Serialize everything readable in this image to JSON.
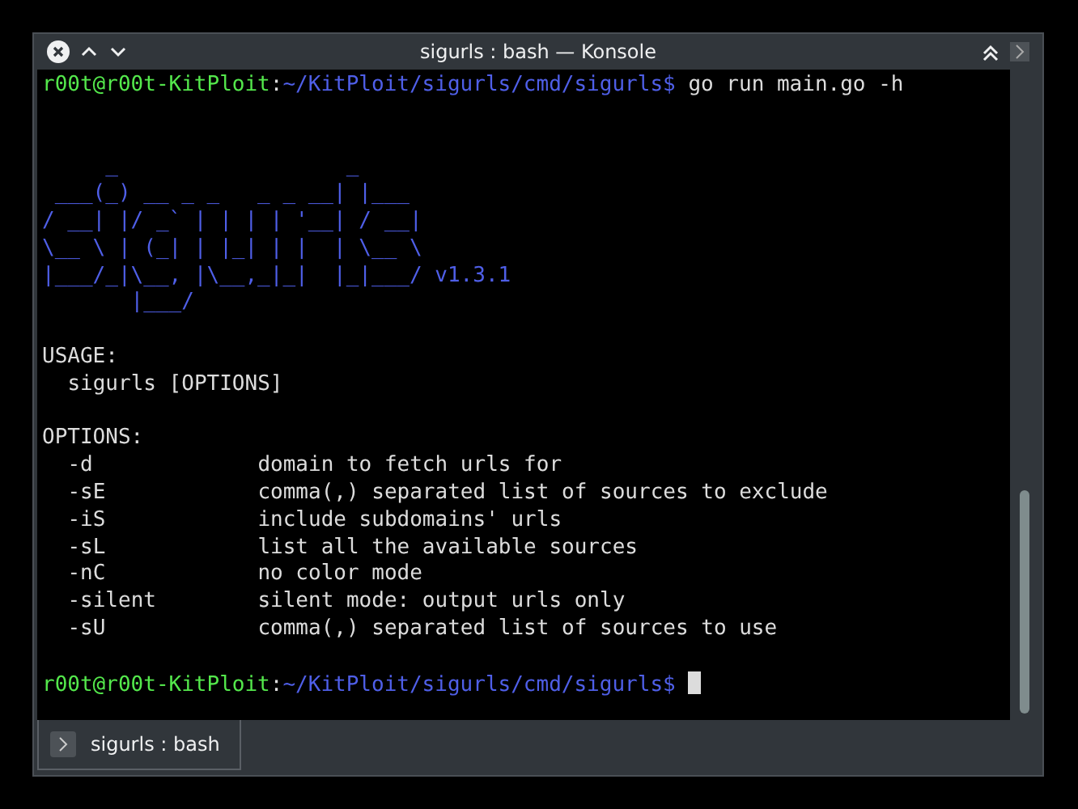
{
  "window": {
    "title": "sigurls : bash — Konsole"
  },
  "terminal": {
    "command": {
      "user_host": "r00t@r00t-KitPloit",
      "separator": ":",
      "path": "~/KitPloit/sigurls/cmd/sigurls$",
      "input": "go run main.go -h"
    },
    "banner": {
      "lines": [
        "     _                  _",
        " ___(_) __ _ _   _ _ __| |___",
        "/ __| |/ _` | | | | '__| / __|",
        "\\__ \\ | (_| | |_| | |  | \\__ \\",
        "|___/_|\\__, |\\__,_|_|  |_|___/",
        "       |___/"
      ],
      "version": "v1.3.1"
    },
    "usage": {
      "heading": "USAGE:",
      "text": "sigurls [OPTIONS]"
    },
    "options": {
      "heading": "OPTIONS:",
      "items": [
        {
          "flag": "-d",
          "description": "domain to fetch urls for"
        },
        {
          "flag": "-sE",
          "description": "comma(,) separated list of sources to exclude"
        },
        {
          "flag": "-iS",
          "description": "include subdomains' urls"
        },
        {
          "flag": "-sL",
          "description": "list all the available sources"
        },
        {
          "flag": "-nC",
          "description": "no color mode"
        },
        {
          "flag": "-silent",
          "description": "silent mode: output urls only"
        },
        {
          "flag": "-sU",
          "description": "comma(,) separated list of sources to use"
        }
      ]
    },
    "prompt": {
      "user_host": "r00t@r00t-KitPloit",
      "separator": ":",
      "path": "~/KitPloit/sigurls/cmd/sigurls$"
    }
  },
  "tabs": [
    {
      "label": "sigurls : bash",
      "selected": true
    }
  ]
}
